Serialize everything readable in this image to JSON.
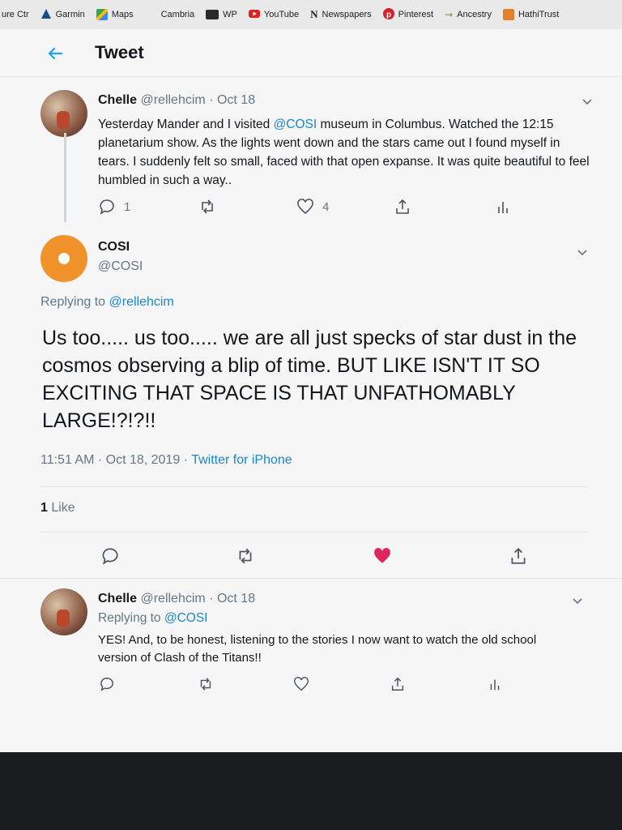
{
  "bookmarks": [
    {
      "label": "ure Ctr",
      "icon": "bookmark-icon",
      "color": "#7a7a7a"
    },
    {
      "label": "Garmin",
      "icon": "garmin-triangle-icon",
      "color": "#1b4f8a"
    },
    {
      "label": "Maps",
      "icon": "maps-icon",
      "color": "#34a853"
    },
    {
      "label": "Cambria",
      "icon": "",
      "color": ""
    },
    {
      "label": "WP",
      "icon": "wp-icon",
      "color": "#2b2b2b"
    },
    {
      "label": "YouTube",
      "icon": "youtube-icon",
      "color": "#e02020"
    },
    {
      "label": "Newspapers",
      "icon": "newspapers-n-icon",
      "color": "#111111"
    },
    {
      "label": "Pinterest",
      "icon": "pinterest-icon",
      "color": "#d4202a"
    },
    {
      "label": "Ancestry",
      "icon": "ancestry-leaf-icon",
      "color": "#7aa43b"
    },
    {
      "label": "HathiTrust",
      "icon": "hathitrust-icon",
      "color": "#e0822c"
    }
  ],
  "header": {
    "title": "Tweet",
    "back_icon": "arrow-left-icon"
  },
  "tweet1": {
    "name": "Chelle",
    "handle": "@rellehcim",
    "date": "· Oct 18",
    "text_pre": "Yesterday Mander and I visited ",
    "mention": "@COSI",
    "text_post": " museum in Columbus. Watched the 12:15 planetarium show. As the lights went down and the stars came out I found myself in tears. I suddenly felt so small, faced with that open expanse. It was quite beautiful to feel humbled in such a way..",
    "replies": "1",
    "likes": "4"
  },
  "main_tweet": {
    "name": "COSI",
    "handle": "@COSI",
    "replying_label": "Replying to ",
    "replying_to": "@rellehcim",
    "text": "Us too..... us too..... we are all just specks of star dust in the cosmos observing a blip of time. BUT LIKE ISN'T IT SO EXCITING THAT SPACE IS THAT UNFATHOMABLY LARGE!?!?!!",
    "timestamp": "11:51 AM · Oct 18, 2019 · ",
    "source": "Twitter for iPhone",
    "like_count": "1",
    "like_label": " Like",
    "liked_color": "#e0245e"
  },
  "tweet3": {
    "name": "Chelle",
    "handle": "@rellehcim",
    "date": "· Oct 18",
    "replying_label": "Replying to ",
    "replying_to": "@COSI",
    "text": "YES!  And, to be honest, listening to the stories I now want to watch the old school version of Clash of the Titans!!"
  },
  "colors": {
    "accent": "#1da1f2",
    "link": "#1b86c9",
    "muted": "#657786"
  }
}
